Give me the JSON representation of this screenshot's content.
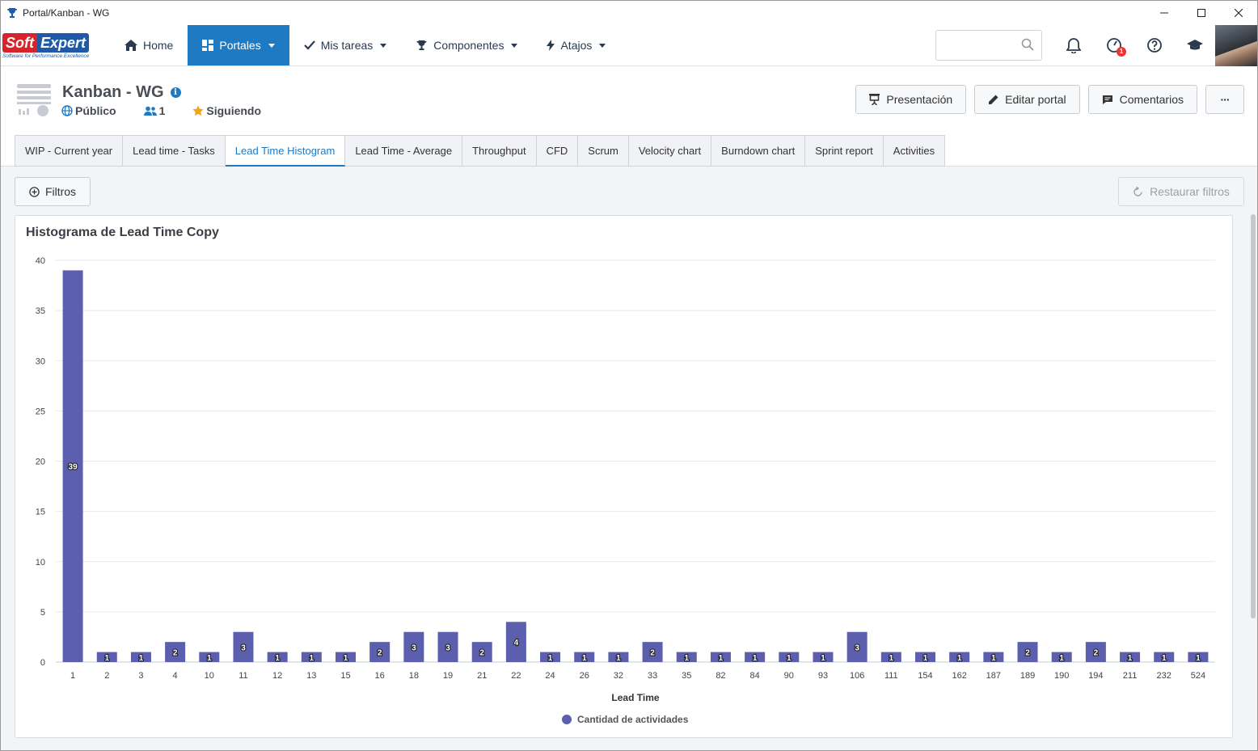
{
  "window": {
    "title": "Portal/Kanban - WG",
    "app_icon": "trophy-icon",
    "controls": [
      "minimize-icon",
      "maximize-icon",
      "close-icon"
    ]
  },
  "topnav": {
    "logo": {
      "brand_soft": "Soft",
      "brand_expert": "Expert",
      "tagline": "Software for Performance Excellence"
    },
    "items": [
      {
        "label": "Home",
        "icon": "home-icon"
      },
      {
        "label": "Portales",
        "icon": "dashboard-icon",
        "active": true
      },
      {
        "label": "Mis tareas",
        "icon": "check-icon"
      },
      {
        "label": "Componentes",
        "icon": "trophy-icon"
      },
      {
        "label": "Atajos",
        "icon": "bolt-icon"
      }
    ],
    "search": {
      "placeholder": ""
    },
    "notification_badge": "1"
  },
  "header": {
    "title": "Kanban - WG",
    "visibility": "Público",
    "members": "1",
    "following": "Siguiendo",
    "actions": {
      "presentation": "Presentación",
      "edit": "Editar portal",
      "comments": "Comentarios",
      "more": "···"
    }
  },
  "tabs": [
    {
      "label": "WIP - Current year"
    },
    {
      "label": "Lead time - Tasks"
    },
    {
      "label": "Lead Time Histogram",
      "active": true
    },
    {
      "label": "Lead Time - Average"
    },
    {
      "label": "Throughput"
    },
    {
      "label": "CFD"
    },
    {
      "label": "Scrum"
    },
    {
      "label": "Velocity chart"
    },
    {
      "label": "Burndown chart"
    },
    {
      "label": "Sprint report"
    },
    {
      "label": "Activities"
    }
  ],
  "filters": {
    "label": "Filtros",
    "restore": "Restaurar filtros"
  },
  "colors": {
    "accent": "#1f7ac4",
    "bar": "#5c5fad"
  },
  "chart_data": {
    "type": "bar",
    "title": "Histograma de Lead Time Copy",
    "xlabel": "Lead Time",
    "ylabel": "",
    "ylim": [
      0,
      40
    ],
    "yticks": [
      0,
      5,
      10,
      15,
      20,
      25,
      30,
      35,
      40
    ],
    "grid": true,
    "legend_position": "bottom",
    "categories": [
      "1",
      "2",
      "3",
      "4",
      "10",
      "11",
      "12",
      "13",
      "15",
      "16",
      "18",
      "19",
      "21",
      "22",
      "24",
      "26",
      "32",
      "33",
      "35",
      "82",
      "84",
      "90",
      "93",
      "106",
      "111",
      "154",
      "162",
      "187",
      "189",
      "190",
      "194",
      "211",
      "232",
      "524"
    ],
    "series": [
      {
        "name": "Cantidad de actividades",
        "values": [
          39,
          1,
          1,
          2,
          1,
          3,
          1,
          1,
          1,
          2,
          3,
          3,
          2,
          4,
          1,
          1,
          1,
          2,
          1,
          1,
          1,
          1,
          1,
          3,
          1,
          1,
          1,
          1,
          2,
          1,
          2,
          1,
          1,
          1
        ]
      }
    ]
  }
}
